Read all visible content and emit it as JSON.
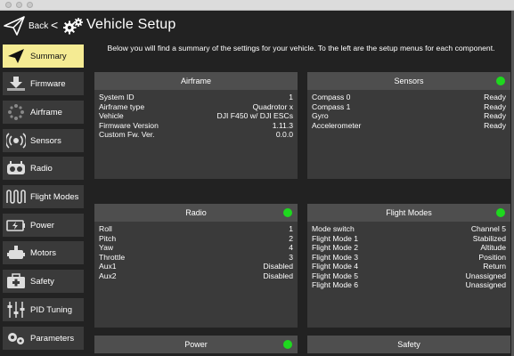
{
  "header": {
    "back_label": "Back",
    "chevron": "<",
    "title": "Vehicle Setup",
    "back_icon": "paper-plane-icon",
    "title_icon": "gears-icon"
  },
  "sidebar": {
    "items": [
      {
        "label": "Summary",
        "icon": "paper-plane-icon",
        "active": true
      },
      {
        "label": "Firmware",
        "icon": "download-icon",
        "active": false
      },
      {
        "label": "Airframe",
        "icon": "airframe-icon",
        "active": false
      },
      {
        "label": "Sensors",
        "icon": "sensors-icon",
        "active": false
      },
      {
        "label": "Radio",
        "icon": "radio-icon",
        "active": false
      },
      {
        "label": "Flight Modes",
        "icon": "waveform-icon",
        "active": false
      },
      {
        "label": "Power",
        "icon": "power-icon",
        "active": false
      },
      {
        "label": "Motors",
        "icon": "motor-icon",
        "active": false
      },
      {
        "label": "Safety",
        "icon": "first-aid-icon",
        "active": false
      },
      {
        "label": "PID Tuning",
        "icon": "sliders-icon",
        "active": false
      },
      {
        "label": "Parameters",
        "icon": "gears-icon",
        "active": false
      }
    ]
  },
  "intro": "Below you will find a summary of the settings for your vehicle. To the left are the setup menus for each component.",
  "colors": {
    "status_ok": "#1ed81e",
    "active_nav": "#f5eb93",
    "panel_header": "#4e4e4e",
    "panel_body": "#3a3a3a"
  },
  "panels": {
    "airframe": {
      "title": "Airframe",
      "rows": [
        {
          "label": "System ID",
          "value": "1"
        },
        {
          "label": "Airframe type",
          "value": "Quadrotor x"
        },
        {
          "label": "Vehicle",
          "value": "DJI F450 w/ DJI ESCs"
        },
        {
          "label": "Firmware Version",
          "value": "1.11.3"
        },
        {
          "label": "Custom Fw. Ver.",
          "value": "0.0.0"
        }
      ]
    },
    "sensors": {
      "title": "Sensors",
      "rows": [
        {
          "label": "Compass 0",
          "value": "Ready"
        },
        {
          "label": "Compass 1",
          "value": "Ready"
        },
        {
          "label": "Gyro",
          "value": "Ready"
        },
        {
          "label": "Accelerometer",
          "value": "Ready"
        }
      ]
    },
    "radio": {
      "title": "Radio",
      "rows": [
        {
          "label": "Roll",
          "value": "1"
        },
        {
          "label": "Pitch",
          "value": "2"
        },
        {
          "label": "Yaw",
          "value": "4"
        },
        {
          "label": "Throttle",
          "value": "3"
        },
        {
          "label": "Aux1",
          "value": "Disabled"
        },
        {
          "label": "Aux2",
          "value": "Disabled"
        }
      ]
    },
    "flight_modes": {
      "title": "Flight Modes",
      "rows": [
        {
          "label": "Mode switch",
          "value": "Channel 5"
        },
        {
          "label": "Flight Mode 1",
          "value": "Stabilized"
        },
        {
          "label": "Flight Mode 2",
          "value": "Altitude"
        },
        {
          "label": "Flight Mode 3",
          "value": "Position"
        },
        {
          "label": "Flight Mode 4",
          "value": "Return"
        },
        {
          "label": "Flight Mode 5",
          "value": "Unassigned"
        },
        {
          "label": "Flight Mode 6",
          "value": "Unassigned"
        }
      ]
    },
    "power": {
      "title": "Power"
    },
    "safety": {
      "title": "Safety"
    }
  }
}
